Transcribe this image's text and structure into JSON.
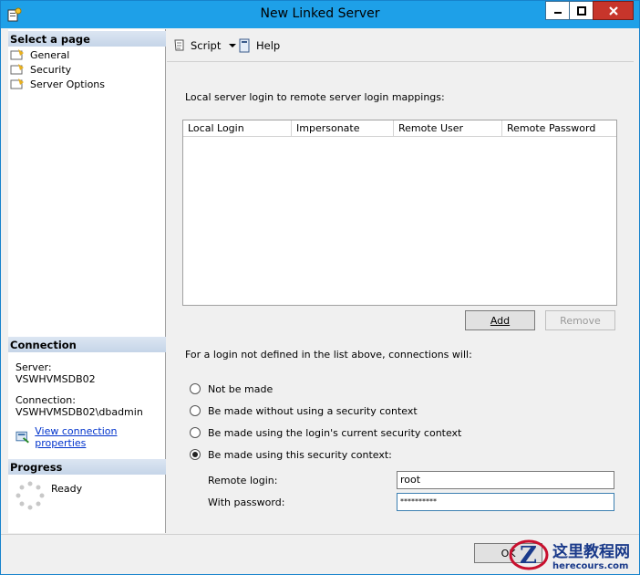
{
  "window": {
    "title": "New Linked Server"
  },
  "left": {
    "select_page_header": "Select a page",
    "pages": [
      {
        "label": "General"
      },
      {
        "label": "Security"
      },
      {
        "label": "Server Options"
      }
    ],
    "connection_header": "Connection",
    "server_label": "Server:",
    "server_value": "VSWHVMSDB02",
    "connection_label": "Connection:",
    "connection_value": "VSWHVMSDB02\\dbadmin",
    "view_props_link": "View connection properties",
    "progress_header": "Progress",
    "progress_status": "Ready"
  },
  "toolbar": {
    "script_label": "Script",
    "help_label": "Help"
  },
  "main": {
    "mappings_label": "Local server login to remote server login mappings:",
    "columns": [
      "Local Login",
      "Impersonate",
      "Remote User",
      "Remote Password"
    ],
    "add_button": "Add",
    "remove_button": "Remove",
    "connections_label": "For a login not defined in the list above, connections will:",
    "options": [
      {
        "label": "Not be made",
        "checked": false
      },
      {
        "label": "Be made without using a security context",
        "checked": false
      },
      {
        "label": "Be made using the login's current security context",
        "checked": false
      },
      {
        "label": "Be made using this security context:",
        "checked": true
      }
    ],
    "remote_login_label": "Remote login:",
    "remote_login_value": "root",
    "password_label": "With password:",
    "password_value": "**********"
  },
  "footer": {
    "ok_button": "OK"
  },
  "watermark": {
    "text": "这里教程网",
    "subtext": "herecours.com"
  },
  "colors": {
    "titlebar": "#1ea0e8",
    "close": "#c7352b",
    "link": "#0033cc"
  }
}
